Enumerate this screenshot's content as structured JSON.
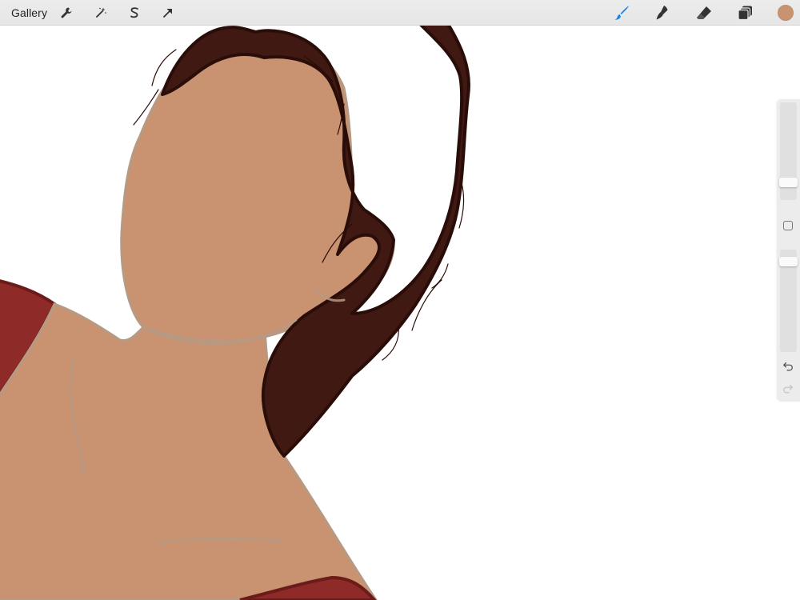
{
  "app": {
    "gallery_label": "Gallery",
    "current_color": "#c99270",
    "active_tool_color": "#1a84e6"
  },
  "toolbar_left": [
    {
      "name": "actions-wrench-icon"
    },
    {
      "name": "adjustments-wand-icon"
    },
    {
      "name": "selection-s-icon"
    },
    {
      "name": "transform-arrow-icon"
    }
  ],
  "toolbar_right": [
    {
      "name": "paint-brush-icon",
      "active": true
    },
    {
      "name": "smudge-icon",
      "active": false
    },
    {
      "name": "eraser-icon",
      "active": false
    },
    {
      "name": "layers-icon",
      "active": false
    }
  ],
  "sidebar": {
    "brush_size_level": 0.15,
    "opacity_level": 0.92,
    "undo_icon": "undo-arrow-icon",
    "redo_icon": "redo-arrow-icon"
  },
  "artwork": {
    "skin_color": "#c99270",
    "skin_line_color": "#b69a84",
    "hair_color": "#3f1912",
    "hair_outline_color": "#2a0d08",
    "clothing_color": "#8e2a28",
    "clothing_outline_color": "#6b1c1a"
  }
}
